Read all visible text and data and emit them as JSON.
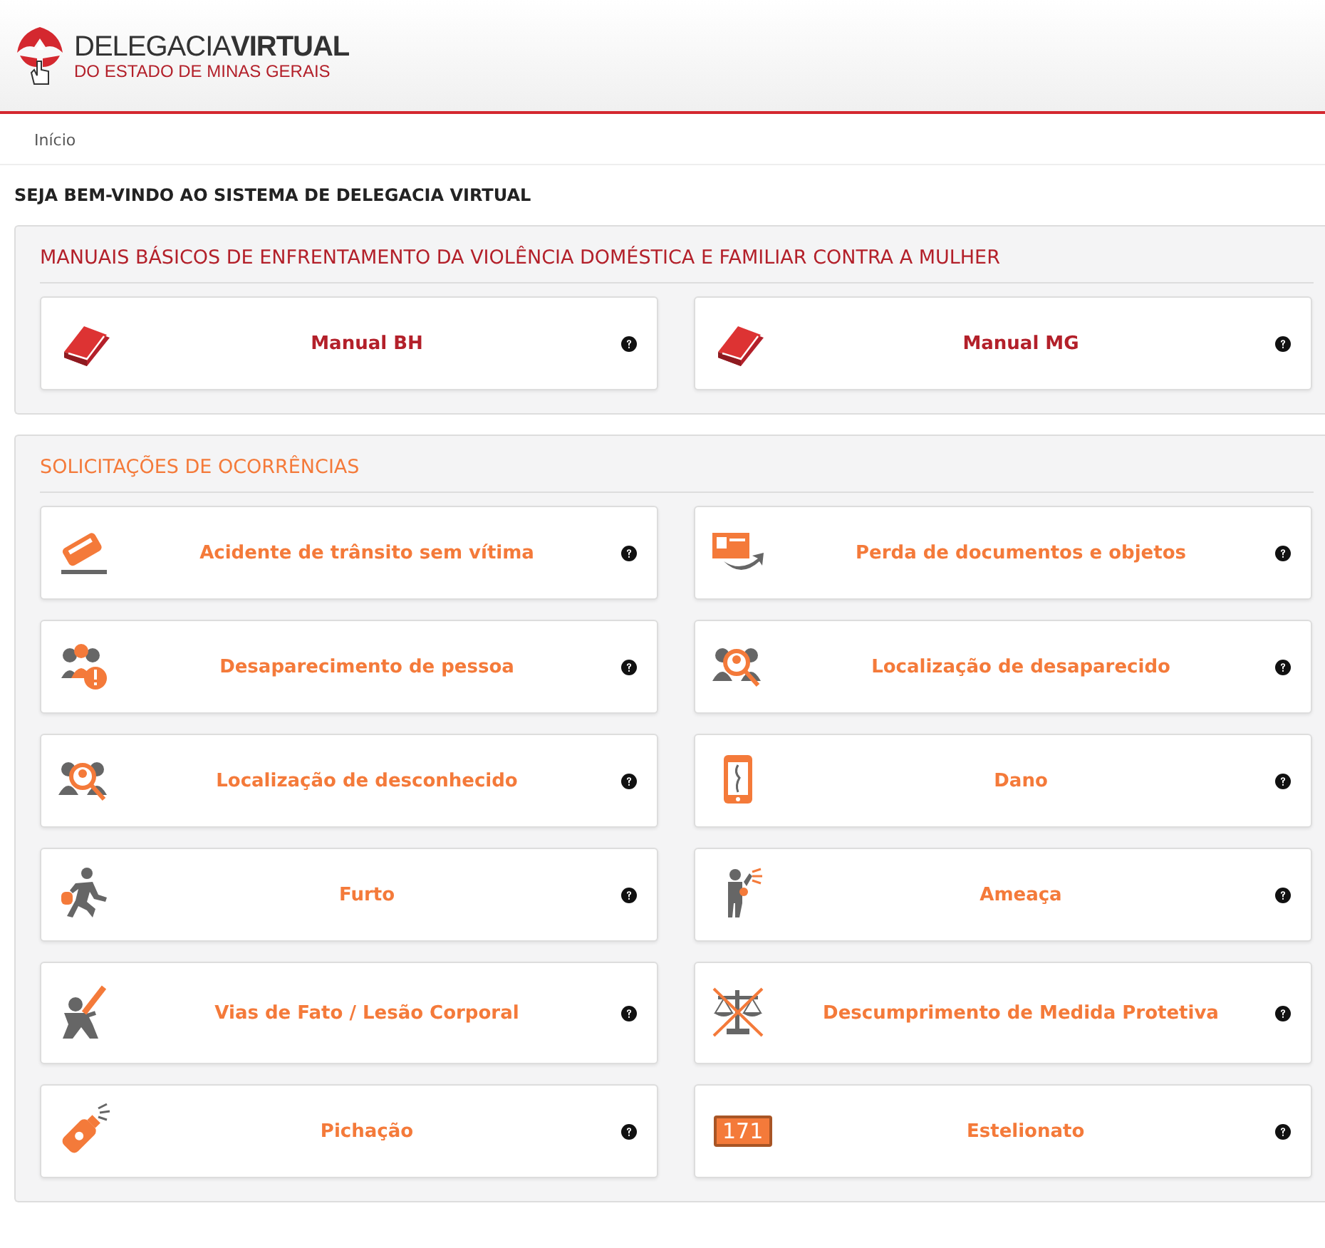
{
  "header": {
    "logo_line1_light": "DELEGACIA",
    "logo_line1_bold": "VIRTUAL",
    "logo_line2": "DO ESTADO DE MINAS GERAIS"
  },
  "breadcrumb": [
    "Início"
  ],
  "page_title": "SEJA BEM-VINDO AO SISTEMA DE DELEGACIA VIRTUAL",
  "sections": [
    {
      "kind": "manual",
      "title": "MANUAIS BÁSICOS DE ENFRENTAMENTO DA VIOLÊNCIA DOMÉSTICA E FAMILIAR CONTRA A MULHER",
      "items": [
        {
          "label": "Manual BH"
        },
        {
          "label": "Manual MG"
        }
      ]
    },
    {
      "kind": "occurrence",
      "title": "SOLICITAÇÕES DE OCORRÊNCIAS",
      "items": [
        {
          "label": "Acidente de trânsito sem vítima"
        },
        {
          "label": "Perda de documentos e objetos"
        },
        {
          "label": "Desaparecimento de pessoa"
        },
        {
          "label": "Localização de desaparecido"
        },
        {
          "label": "Localização de desconhecido"
        },
        {
          "label": "Dano"
        },
        {
          "label": "Furto"
        },
        {
          "label": "Ameaça"
        },
        {
          "label": "Vias de Fato / Lesão Corporal"
        },
        {
          "label": "Descumprimento de Medida Protetiva"
        },
        {
          "label": "Pichação"
        },
        {
          "label": "Estelionato",
          "badge": "171"
        }
      ]
    }
  ]
}
